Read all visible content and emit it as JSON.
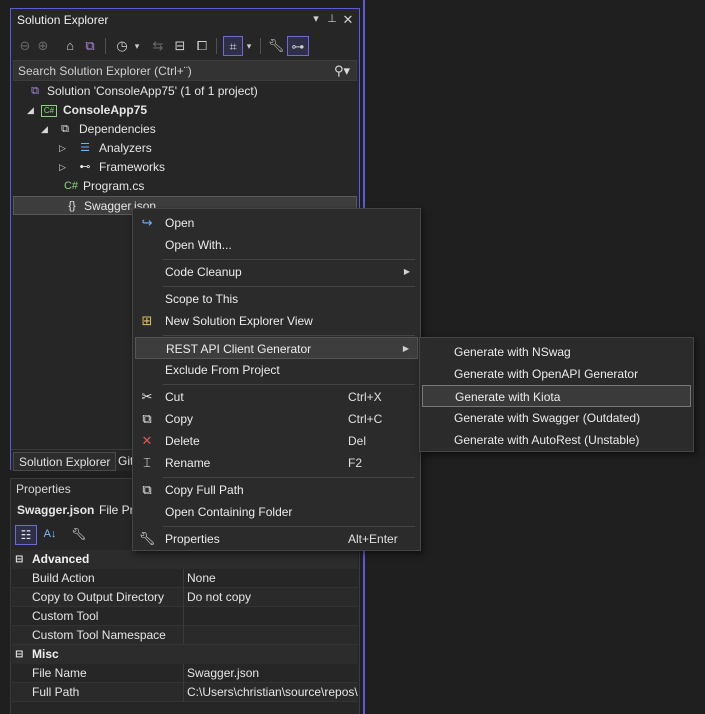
{
  "explorer": {
    "title": "Solution Explorer",
    "search_placeholder": "Search Solution Explorer (Ctrl+¨)",
    "tree": {
      "solution": "Solution 'ConsoleApp75' (1 of 1 project)",
      "project": "ConsoleApp75",
      "dependencies": "Dependencies",
      "analyzers": "Analyzers",
      "frameworks": "Frameworks",
      "program": "Program.cs",
      "swagger": "Swagger.json"
    },
    "tabs": {
      "solution_explorer": "Solution Explorer",
      "git": "Git"
    }
  },
  "properties": {
    "title": "Properties",
    "object_name": "Swagger.json",
    "object_type": "File Pro",
    "categories": {
      "advanced": "Advanced",
      "misc": "Misc"
    },
    "rows": {
      "build_action": {
        "name": "Build Action",
        "value": "None"
      },
      "copy_output": {
        "name": "Copy to Output Directory",
        "value": "Do not copy"
      },
      "custom_tool": {
        "name": "Custom Tool",
        "value": ""
      },
      "custom_tool_ns": {
        "name": "Custom Tool Namespace",
        "value": ""
      },
      "file_name": {
        "name": "File Name",
        "value": "Swagger.json"
      },
      "full_path": {
        "name": "Full Path",
        "value": "C:\\Users\\christian\\source\\repos\\"
      }
    }
  },
  "context_menu": {
    "open": "Open",
    "open_with": "Open With...",
    "code_cleanup": "Code Cleanup",
    "scope_to_this": "Scope to This",
    "new_view": "New Solution Explorer View",
    "rest_api": "REST API Client Generator",
    "exclude": "Exclude From Project",
    "cut": {
      "label": "Cut",
      "shortcut": "Ctrl+X"
    },
    "copy": {
      "label": "Copy",
      "shortcut": "Ctrl+C"
    },
    "delete": {
      "label": "Delete",
      "shortcut": "Del"
    },
    "rename": {
      "label": "Rename",
      "shortcut": "F2"
    },
    "copy_full_path": "Copy Full Path",
    "open_folder": "Open Containing Folder",
    "properties": {
      "label": "Properties",
      "shortcut": "Alt+Enter"
    }
  },
  "submenu": {
    "nswag": "Generate with NSwag",
    "openapi": "Generate with OpenAPI Generator",
    "kiota": "Generate with Kiota",
    "swagger": "Generate with Swagger (Outdated)",
    "autorest": "Generate with AutoRest (Unstable)"
  },
  "colors": {
    "accent": "#5b5bd6",
    "background": "#1f1f1f",
    "panel": "#262626",
    "menu": "#2b2b2b",
    "csharp_green": "#8bd47f"
  }
}
